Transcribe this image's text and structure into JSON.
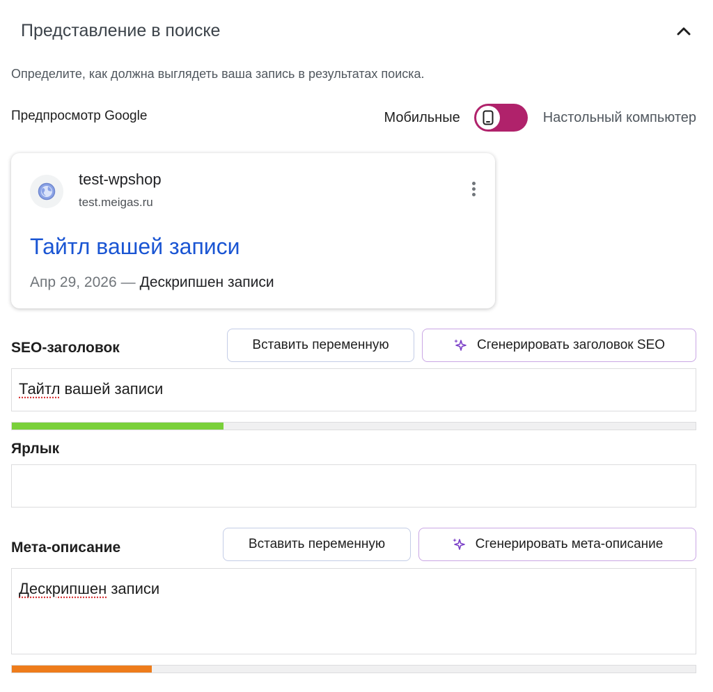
{
  "panel": {
    "title": "Представление в поиске",
    "description": "Определите, как должна выглядеть ваша запись в результатах поиска."
  },
  "preview": {
    "label": "Предпросмотр Google",
    "toggle_mobile_label": "Мобильные",
    "toggle_desktop_label": "Настольный компьютер",
    "toggle_state": "mobile"
  },
  "serp": {
    "site_name": "test-wpshop",
    "site_url": "test.meigas.ru",
    "title": "Тайтл вашей записи",
    "date": "Апр 29, 2026",
    "dash": "—",
    "description": "Дескрипшен записи"
  },
  "seo_title": {
    "label": "SEO-заголовок",
    "insert_variable_label": "Вставить переменную",
    "generate_label": "Сгенерировать заголовок SEO",
    "value": "Тайтл вашей записи",
    "value_misspelled": "Тайтл",
    "value_rest": " вашей записи",
    "progress": 0.31,
    "progress_color": "#7ad03a"
  },
  "slug": {
    "label": "Ярлык",
    "value": ""
  },
  "meta_description": {
    "label": "Мета-описание",
    "insert_variable_label": "Вставить переменную",
    "generate_label": "Сгенерировать мета-описание",
    "value_misspelled": "Дескрипшен",
    "value_rest": " записи",
    "progress": 0.205,
    "progress_color": "#ee7c1b"
  },
  "colors": {
    "accent": "#b0226b",
    "link": "#1a55d3",
    "ai_border": "#c9a6e4",
    "ai_icon": "#7a3ec7"
  },
  "icons": {
    "collapse": "chevron-up-icon",
    "toggle": "smartphone-icon",
    "favicon": "globe-icon",
    "more": "more-vertical-icon",
    "ai": "sparkles-icon"
  }
}
